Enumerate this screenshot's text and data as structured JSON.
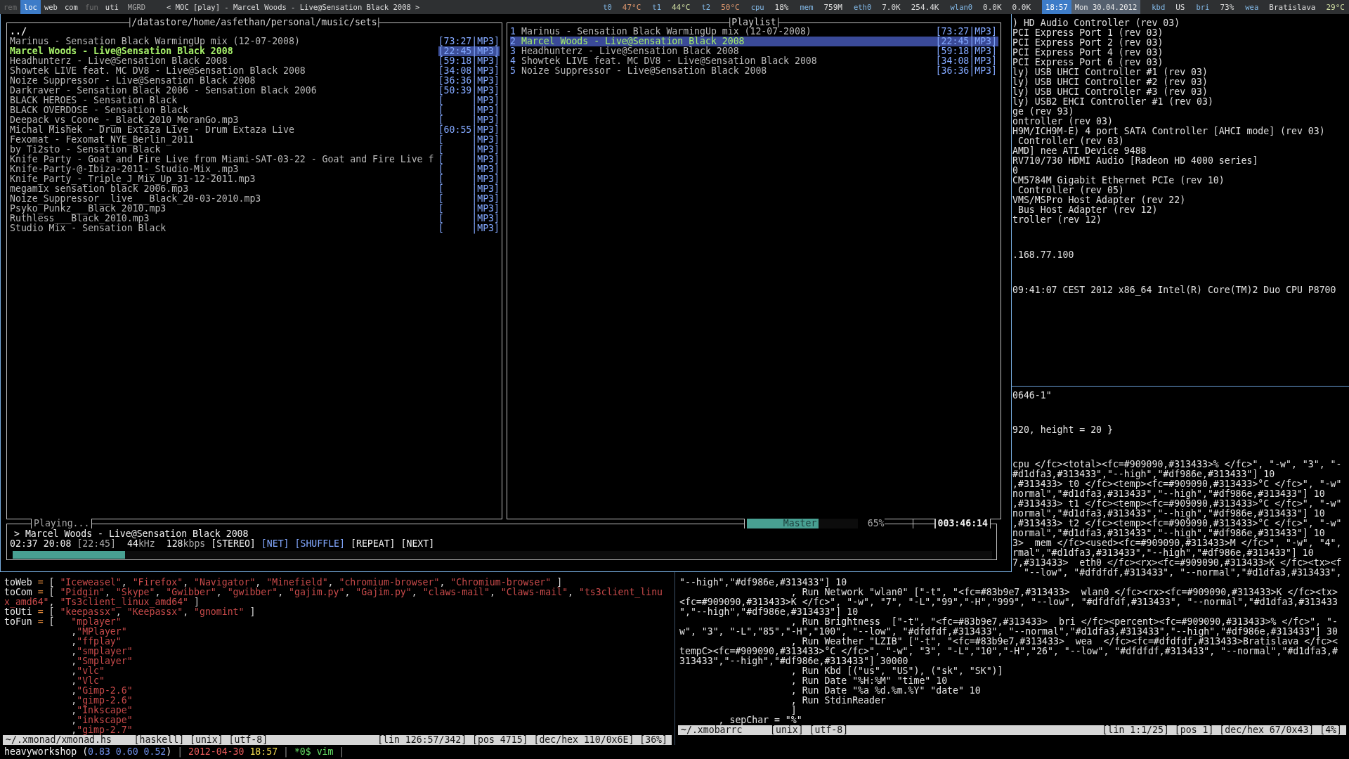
{
  "topbar": {
    "workspaces": [
      {
        "label": "rem",
        "selected": false,
        "empty": true
      },
      {
        "label": "loc",
        "selected": true,
        "empty": false
      },
      {
        "label": "web",
        "selected": false,
        "empty": false
      },
      {
        "label": "com",
        "selected": false,
        "empty": false
      },
      {
        "label": "fun",
        "selected": false,
        "empty": true
      },
      {
        "label": "uti",
        "selected": false,
        "empty": false
      }
    ],
    "layout": "MGRD",
    "title": "< MOC [play] - Marcel Woods - Live@Sensation Black 2008 >",
    "stats": [
      {
        "kind": "stat",
        "label": "t0",
        "values": [
          {
            "text": "47°C",
            "color": "#df986e"
          }
        ]
      },
      {
        "kind": "stat",
        "label": "t1",
        "values": [
          {
            "text": "44°C",
            "color": "#d1dfa3"
          }
        ]
      },
      {
        "kind": "stat",
        "label": "t2",
        "values": [
          {
            "text": "50°C",
            "color": "#df986e"
          }
        ]
      },
      {
        "kind": "stat",
        "label": "cpu",
        "values": [
          {
            "text": "18%",
            "color": "#dfdfdf"
          }
        ]
      },
      {
        "kind": "stat",
        "label": "mem",
        "values": [
          {
            "text": "759M",
            "color": "#dfdfdf"
          }
        ]
      },
      {
        "kind": "stat",
        "label": "eth0",
        "values": [
          {
            "text": "7.0K",
            "color": "#dfdfdf"
          },
          {
            "text": "254.4K",
            "color": "#dfdfdf"
          }
        ]
      },
      {
        "kind": "stat",
        "label": "wlan0",
        "values": [
          {
            "text": "0.0K",
            "color": "#dfdfdf"
          },
          {
            "text": "0.0K",
            "color": "#dfdfdf"
          }
        ]
      },
      {
        "kind": "clock",
        "text": "18:57"
      },
      {
        "kind": "date",
        "text": "Mon 30.04.2012"
      },
      {
        "kind": "stat",
        "label": "kbd",
        "values": [
          {
            "text": "US",
            "color": "#dfdfdf"
          }
        ]
      },
      {
        "kind": "stat",
        "label": "bri",
        "values": [
          {
            "text": "73%",
            "color": "#dfdfdf"
          }
        ]
      },
      {
        "kind": "stat",
        "label": "wea",
        "values": [
          {
            "text": "Bratislava",
            "color": "#dfdfdf"
          },
          {
            "text": "29°C",
            "color": "#d1dfa3"
          }
        ]
      }
    ]
  },
  "terminal": {
    "blocks": [
      [
        ") HD Audio Controller (rev 03)",
        "PCI Express Port 1 (rev 03)",
        "PCI Express Port 2 (rev 03)",
        "PCI Express Port 4 (rev 03)",
        "PCI Express Port 6 (rev 03)",
        "ly) USB UHCI Controller #1 (rev 03)",
        "ly) USB UHCI Controller #2 (rev 03)",
        "ly) USB UHCI Controller #3 (rev 03)",
        "ly) USB2 EHCI Controller #1 (rev 03)",
        "ge (rev 93)",
        "ontroller (rev 03)",
        "H9M/ICH9M-E) 4 port SATA Controller [AHCI mode] (rev 03)",
        " Controller (rev 03)",
        "AMD] nee ATI Device 9488",
        "RV710/730 HDMI Audio [Radeon HD 4000 series]",
        "0",
        "CM5784M Gigabit Ethernet PCIe (rev 10)",
        " Controller (rev 05)",
        "VMS/MSPro Host Adapter (rev 22)",
        " Bus Host Adapter (rev 12)",
        "troller (rev 12)"
      ],
      [
        ".168.77.100"
      ],
      [
        "09:41:07 CEST 2012 x86_64 Intel(R) Core(TM)2 Duo CPU P8700"
      ]
    ]
  },
  "moc": {
    "browser": {
      "path": "/datastore/home/asfethan/personal/music/sets",
      "parent": "../",
      "rows": [
        {
          "name": "Marinus - Sensation Black WarmingUp mix (12-07-2008)",
          "info": "[73:27|MP3]",
          "selected": false
        },
        {
          "name": "Marcel Woods - Live@Sensation Black 2008",
          "info": "[22:45|MP3]",
          "selected": true
        },
        {
          "name": "Headhunterz - Live@Sensation Black 2008",
          "info": "[59:18|MP3]",
          "selected": false
        },
        {
          "name": "Showtek LIVE feat. MC DV8 - Live@Sensation Black 2008",
          "info": "[34:08|MP3]",
          "selected": false
        },
        {
          "name": "Noize Suppressor - Live@Sensation Black 2008",
          "info": "[36:36|MP3]",
          "selected": false
        },
        {
          "name": "Darkraver - Sensation Black 2006 - Sensation Black 2006",
          "info": "[50:39|MP3]",
          "selected": false
        },
        {
          "name": "BLACK HEROES - Sensation Black",
          "info": "[     |MP3]",
          "selected": false
        },
        {
          "name": "BLACK OVERDOSE - Sensation Black",
          "info": "[     |MP3]",
          "selected": false
        },
        {
          "name": "Deepack_vs_Coone_-_Black_2010_MoranGo.mp3",
          "info": "[     |MP3]",
          "selected": false
        },
        {
          "name": "Michal Mishek - Drum Extaza Live - Drum Extaza Live",
          "info": "[60:55|MP3]",
          "selected": false
        },
        {
          "name": "Fexomat - Fexomat_NYE_Berlin_2011",
          "info": "[     |MP3]",
          "selected": false
        },
        {
          "name": "by Ti2sto - Sensation Black",
          "info": "[     |MP3]",
          "selected": false
        },
        {
          "name": "Knife Party - Goat and Fire Live from Miami-SAT-03-22 - Goat and Fire Live f",
          "info": "[     |MP3]",
          "selected": false
        },
        {
          "name": "Knife-Party-@-Ibiza-2011-_Studio-Mix_.mp3",
          "info": "[     |MP3]",
          "selected": false
        },
        {
          "name": "Knife_Party_-_Triple_J_Mix_Up_31-12-2011.mp3",
          "info": "[     |MP3]",
          "selected": false
        },
        {
          "name": "megamix sensation black 2006.mp3",
          "info": "[     |MP3]",
          "selected": false
        },
        {
          "name": "Noize_Suppressor__live___Black_20-03-2010.mp3",
          "info": "[     |MP3]",
          "selected": false
        },
        {
          "name": "Psyko_Punkz___Black_2010.mp3",
          "info": "[     |MP3]",
          "selected": false
        },
        {
          "name": "Ruthless___Black_2010.mp3",
          "info": "[     |MP3]",
          "selected": false
        },
        {
          "name": "Studio Mix - Sensation Black",
          "info": "[     |MP3]",
          "selected": false
        }
      ]
    },
    "playlist": {
      "title": "Playlist",
      "rows": [
        {
          "number": "1",
          "name": "Marinus - Sensation Black WarmingUp mix (12-07-2008)",
          "info": "[73:27|MP3]",
          "selected": false
        },
        {
          "number": "2",
          "name": "Marcel Woods - Live@Sensation Black 2008",
          "info": "[22:45|MP3]",
          "selected": true
        },
        {
          "number": "3",
          "name": "Headhunterz - Live@Sensation Black 2008",
          "info": "[59:18|MP3]",
          "selected": false
        },
        {
          "number": "4",
          "name": "Showtek LIVE feat. MC DV8 - Live@Sensation Black 2008",
          "info": "[34:08|MP3]",
          "selected": false
        },
        {
          "number": "5",
          "name": "Noize Suppressor - Live@Sensation Black 2008",
          "info": "[36:36|MP3]",
          "selected": false
        }
      ]
    },
    "player": {
      "status": "Playing...",
      "now_playing": "> Marcel Woods - Live@Sensation Black 2008",
      "time_played": "02:37",
      "time_left": "20:08",
      "total": "[22:45]",
      "rate": "**44**kHz",
      "bitrate": "**128**kbps",
      "flags": [
        {
          "label": "[STEREO]",
          "on": false
        },
        {
          "label": "[NET]",
          "on": true
        },
        {
          "label": "[SHUFFLE]",
          "on": true
        },
        {
          "label": "[REPEAT]",
          "on": false
        },
        {
          "label": "[NEXT]",
          "on": false
        }
      ],
      "progress": {
        "level": 0.115
      },
      "mixer": {
        "label": "Master",
        "level": 0.65,
        "reading": "65%"
      },
      "total_time": "003:46:14"
    }
  },
  "xmonad_hs": {
    "lines": [
      [
        {
          "kind": "id",
          "t": "toWeb"
        },
        {
          "kind": "op",
          "t": " = "
        },
        {
          "kind": "p",
          "t": "[ "
        },
        {
          "kind": "s",
          "t": "\"Iceweasel\""
        },
        {
          "kind": "p",
          "t": ", "
        },
        {
          "kind": "s",
          "t": "\"Firefox\""
        },
        {
          "kind": "p",
          "t": ", "
        },
        {
          "kind": "s",
          "t": "\"Navigator\""
        },
        {
          "kind": "p",
          "t": ", "
        },
        {
          "kind": "s",
          "t": "\"Minefield\""
        },
        {
          "kind": "p",
          "t": ", "
        },
        {
          "kind": "s",
          "t": "\"chromium-browser\""
        },
        {
          "kind": "p",
          "t": ", "
        },
        {
          "kind": "s",
          "t": "\"Chromium-browser\""
        },
        {
          "kind": "p",
          "t": " ]"
        }
      ],
      [
        {
          "kind": "id",
          "t": "toCom"
        },
        {
          "kind": "op",
          "t": " = "
        },
        {
          "kind": "p",
          "t": "[ "
        },
        {
          "kind": "s",
          "t": "\"Pidgin\""
        },
        {
          "kind": "p",
          "t": ", "
        },
        {
          "kind": "s",
          "t": "\"Skype\""
        },
        {
          "kind": "p",
          "t": ", "
        },
        {
          "kind": "s",
          "t": "\"Gwibber\""
        },
        {
          "kind": "p",
          "t": ", "
        },
        {
          "kind": "s",
          "t": "\"gwibber\""
        },
        {
          "kind": "p",
          "t": ", "
        },
        {
          "kind": "s",
          "t": "\"gajim.py\""
        },
        {
          "kind": "p",
          "t": ", "
        },
        {
          "kind": "s",
          "t": "\"Gajim.py\""
        },
        {
          "kind": "p",
          "t": ", "
        },
        {
          "kind": "s",
          "t": "\"claws-mail\""
        },
        {
          "kind": "p",
          "t": ", "
        },
        {
          "kind": "s",
          "t": "\"Claws-mail\""
        },
        {
          "kind": "p",
          "t": ", "
        },
        {
          "kind": "s",
          "t": "\"ts3client_linu"
        }
      ],
      [
        {
          "kind": "s",
          "t": "x_amd64\""
        },
        {
          "kind": "p",
          "t": ", "
        },
        {
          "kind": "s",
          "t": "\"Ts3client_linux_amd64\""
        },
        {
          "kind": "p",
          "t": " ]"
        }
      ],
      [
        {
          "kind": "id",
          "t": "toUti"
        },
        {
          "kind": "op",
          "t": " = "
        },
        {
          "kind": "p",
          "t": "[ "
        },
        {
          "kind": "s",
          "t": "\"keepassx\""
        },
        {
          "kind": "p",
          "t": ", "
        },
        {
          "kind": "s",
          "t": "\"Keepassx\""
        },
        {
          "kind": "p",
          "t": ", "
        },
        {
          "kind": "s",
          "t": "\"gnomint\""
        },
        {
          "kind": "p",
          "t": " ]"
        }
      ],
      [
        {
          "kind": "id",
          "t": "toFun"
        },
        {
          "kind": "op",
          "t": " = "
        },
        {
          "kind": "p",
          "t": "[   "
        },
        {
          "kind": "s",
          "t": "\"mplayer\""
        }
      ],
      [
        {
          "kind": "p",
          "t": "            ,"
        },
        {
          "kind": "s",
          "t": "\"MPlayer\""
        }
      ],
      [
        {
          "kind": "p",
          "t": "            ,"
        },
        {
          "kind": "s",
          "t": "\"ffplay\""
        }
      ],
      [
        {
          "kind": "p",
          "t": "            ,"
        },
        {
          "kind": "s",
          "t": "\"smplayer\""
        }
      ],
      [
        {
          "kind": "p",
          "t": "            ,"
        },
        {
          "kind": "s",
          "t": "\"Smplayer\""
        }
      ],
      [
        {
          "kind": "p",
          "t": "            ,"
        },
        {
          "kind": "s",
          "t": "\"vlc\""
        }
      ],
      [
        {
          "kind": "p",
          "t": "            ,"
        },
        {
          "kind": "s",
          "t": "\"Vlc\""
        }
      ],
      [
        {
          "kind": "p",
          "t": "            ,"
        },
        {
          "kind": "s",
          "t": "\"Gimp-2.6\""
        }
      ],
      [
        {
          "kind": "p",
          "t": "            ,"
        },
        {
          "kind": "s",
          "t": "\"gimp-2.6\""
        }
      ],
      [
        {
          "kind": "p",
          "t": "            ,"
        },
        {
          "kind": "s",
          "t": "\"Inkscape\""
        }
      ],
      [
        {
          "kind": "p",
          "t": "            ,"
        },
        {
          "kind": "s",
          "t": "\"inkscape\""
        }
      ],
      [
        {
          "kind": "p",
          "t": "            ,"
        },
        {
          "kind": "s",
          "t": "\"gimp-2.7\""
        }
      ]
    ],
    "status_left": "~/.xmonad/xmonad.hs    [haskell] [unix] [utf-8]",
    "status_right": "[lin 126:57/342] [pos 4715] [dec/hex 110/0x6E] [36%]"
  },
  "xmobarrc": {
    "upper_blocks": [
      [
        "0646-1\""
      ],
      [
        "920, height = 20 }"
      ],
      [
        "cpu </fc><total><fc=#909090,#313433>% </fc>\", \"-w\", \"3\", \"-",
        "#d1dfa3,#313433\",\"--high\",\"#df986e,#313433\"] 10",
        ",#313433> t0 </fc><temp><fc=#909090,#313433>°C </fc>\", \"-w\"",
        "normal\",\"#d1dfa3,#313433\",\"--high\",\"#df986e,#313433\"] 10",
        ",#313433> t1 </fc><temp><fc=#909090,#313433>°C </fc>\", \"-w\"",
        "normal\",\"#d1dfa3,#313433\",\"--high\",\"#df986e,#313433\"] 10",
        ",#313433> t2 </fc><temp><fc=#909090,#313433>°C </fc>\", \"-w\"",
        "normal\",\"#d1dfa3,#313433\",\"--high\",\"#df986e,#313433\"] 10",
        "3>  mem </fc><used><fc=#909090,#313433>M </fc>\", \"-w\", \"4\",",
        "rmal\",\"#d1dfa3,#313433\",\"--high\",\"#df986e,#313433\"] 10",
        "7,#313433>  eth0 </fc><rx><fc=#909090,#313433>K </fc><tx><f",
        "  \"--low\", \"#dfdfdf,#313433\", \"--normal\",\"#d1dfa3,#313433\","
      ]
    ],
    "lines": [
      "\"--high\",\"#df986e,#313433\"] 10",
      "                    , Run Network \"wlan0\" [\"-t\", \"<fc=#83b9e7,#313433>  wlan0 </fc><rx><fc=#909090,#313433>K </fc><tx>",
      "<fc=#909090,#313433>K </fc>\", \"-w\", \"7\", \"-L\",\"99\",\"-H\",\"999\", \"--low\", \"#dfdfdf,#313433\", \"--normal\",\"#d1dfa3,#313433",
      "\",\"--high\",\"#df986e,#313433\"] 10",
      "                    , Run Brightness  [\"-t\", \"<fc=#83b9e7,#313433>  bri </fc><percent><fc=#909090,#313433>% </fc>\", \"-",
      "w\", \"3\", \"-L\",\"85\",\"-H\",\"100\", \"--low\", \"#dfdfdf,#313433\", \"--normal\",\"#d1dfa3,#313433\",\"--high\",\"#df986e,#313433\"] 30",
      "                    , Run Weather \"LZIB\" [\"-t\", \"<fc=#83b9e7,#313433>  wea  </fc><fc=#dfdfdf,#313433>Bratislava </fc><",
      "tempC><fc=#909090,#313433>°C </fc>\", \"-w\", \"3\", \"-L\",\"10\",\"-H\",\"26\", \"--low\", \"#dfdfdf,#313433\", \"--normal\",\"#d1dfa3,#",
      "313433\",\"--high\",\"#df986e,#313433\"] 30000",
      "                    , Run Kbd [(\"us\", \"US\"), (\"sk\", \"SK\")]",
      "                    , Run Date \"%H:%M\" \"time\" 10",
      "                    , Run Date \"%a %d.%m.%Y\" \"date\" 10",
      "                    , Run StdinReader",
      "                    ]",
      "       , sepChar = \"%\""
    ],
    "status_left": "~/.xmobarrc     [unix] [utf-8]",
    "status_right": "[lin 1:1/25] [pos 1] [dec/hex 67/0x43] [4%]"
  },
  "screen_bar": [
    {
      "kind": "host",
      "t": "heavyworkshop "
    },
    {
      "kind": "p",
      "t": "("
    },
    {
      "kind": "load",
      "t": "0.83 0.60 0.52"
    },
    {
      "kind": "p",
      "t": ")"
    },
    {
      "kind": "sep",
      "t": " | "
    },
    {
      "kind": "date",
      "t": "2012-04-30"
    },
    {
      "kind": "time",
      "t": " 18:57"
    },
    {
      "kind": "sep",
      "t": " | "
    },
    {
      "kind": "win",
      "t": "*0$ vim"
    },
    {
      "kind": "sep",
      "t": " |"
    }
  ]
}
